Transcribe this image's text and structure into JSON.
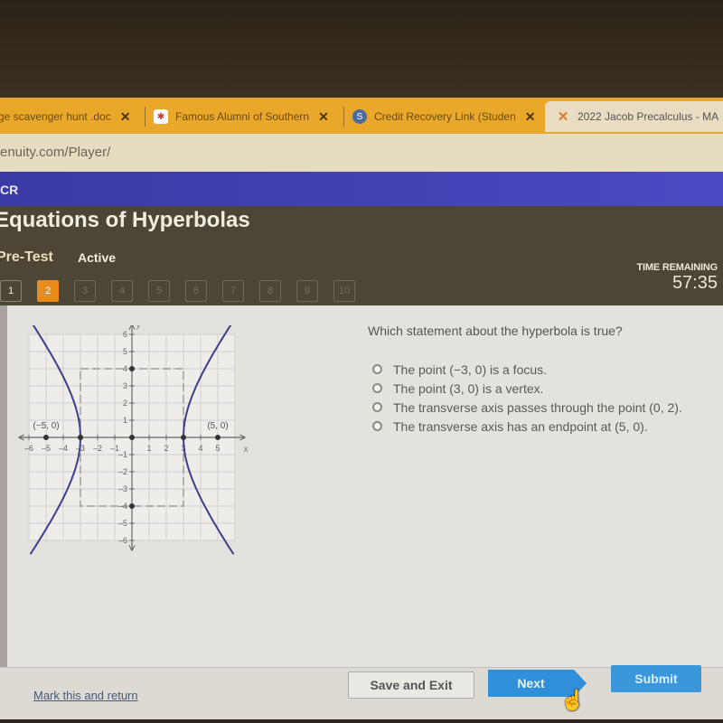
{
  "browser": {
    "tabs": [
      {
        "title": "ge scavenger hunt .doc",
        "favicon": "doc-icon",
        "active": false
      },
      {
        "title": "Famous Alumni of Southern",
        "favicon": "school-logo-icon",
        "active": false
      },
      {
        "title": "Credit Recovery Link (Studen",
        "favicon": "schoology-s-icon",
        "active": false
      },
      {
        "title": "2022 Jacob Precalculus - MA",
        "favicon": "x-logo-icon",
        "active": true
      }
    ],
    "close_glyph": "✕",
    "address": "enuity.com/Player/"
  },
  "app": {
    "brand": "CR",
    "title": "Equations of Hyperbolas",
    "section": "Pre-Test",
    "status": "Active",
    "question_numbers": [
      "1",
      "2",
      "3",
      "4",
      "5",
      "6",
      "7",
      "8",
      "9",
      "10"
    ],
    "current_question": 2,
    "timer": {
      "label": "TIME REMAINING",
      "value": "57:35"
    }
  },
  "question": {
    "prompt": "Which statement about the hyperbola is true?",
    "choices": [
      "The point (−3, 0) is a focus.",
      "The point (3, 0) is a vertex.",
      "The transverse axis passes through the point (0, 2).",
      "The transverse axis has an endpoint at (5, 0)."
    ]
  },
  "graph": {
    "x_label": "x",
    "y_label": "y",
    "x_ticks": [
      "-6",
      "-5",
      "-4",
      "-3",
      "-2",
      "-1",
      "1",
      "2",
      "3",
      "4",
      "5"
    ],
    "y_ticks": [
      "6",
      "5",
      "4",
      "3",
      "2",
      "1",
      "-1",
      "-2",
      "-3",
      "-4",
      "-5",
      "-6"
    ],
    "points": [
      {
        "x": -5,
        "y": 0,
        "label": "(−5, 0)"
      },
      {
        "x": 5,
        "y": 0,
        "label": "(5, 0)"
      },
      {
        "x": -3,
        "y": 0,
        "label": ""
      },
      {
        "x": 3,
        "y": 0,
        "label": ""
      },
      {
        "x": 0,
        "y": 0,
        "label": ""
      },
      {
        "x": 0,
        "y": 4,
        "label": ""
      },
      {
        "x": 0,
        "y": -4,
        "label": ""
      }
    ],
    "a": 3,
    "b": 4,
    "range": [
      -6,
      6
    ],
    "curve_color": "#3d3f8c"
  },
  "footer": {
    "mark_link": "Mark this and return",
    "save_label": "Save and Exit",
    "next_label": "Next",
    "submit_label": "Submit"
  }
}
